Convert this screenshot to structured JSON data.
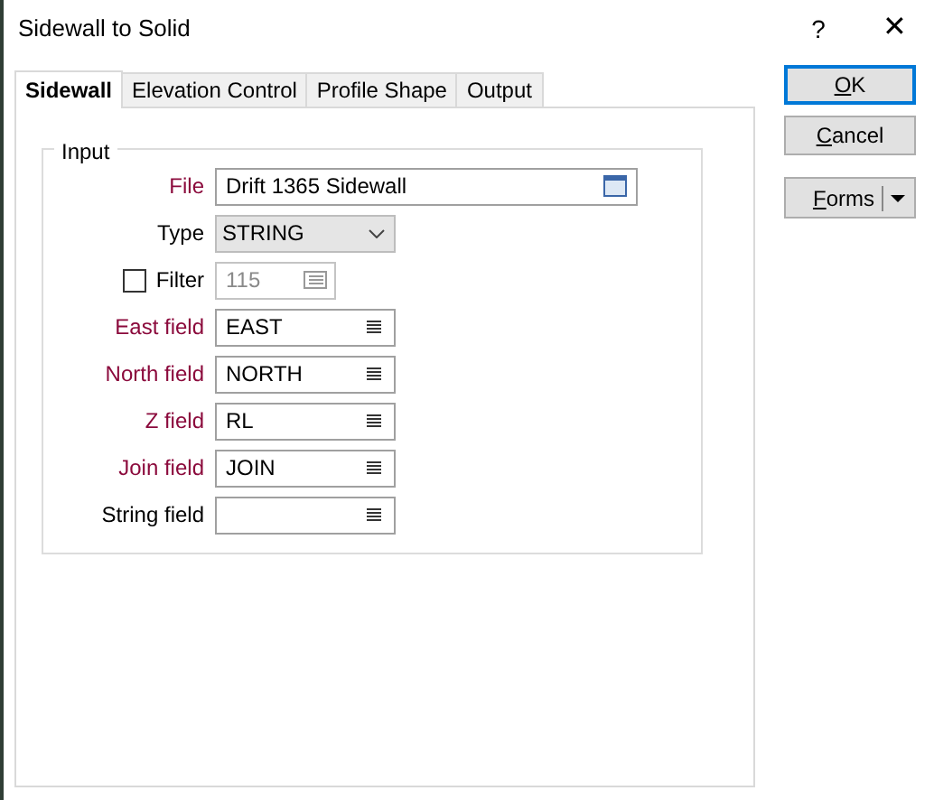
{
  "window": {
    "title": "Sidewall to Solid",
    "help": "?",
    "close": "✕"
  },
  "tabs": [
    {
      "label": "Sidewall",
      "selected": true
    },
    {
      "label": "Elevation Control",
      "selected": false
    },
    {
      "label": "Profile Shape",
      "selected": false
    },
    {
      "label": "Output",
      "selected": false
    }
  ],
  "group": {
    "title": "Input"
  },
  "fields": [
    {
      "kind": "file",
      "label": "File",
      "required": true,
      "value": "Drift 1365 Sidewall"
    },
    {
      "kind": "dropdown",
      "label": "Type",
      "required": false,
      "value": "STRING"
    },
    {
      "kind": "filter",
      "label": "Filter",
      "checked": false,
      "disabled": true,
      "value": "115"
    },
    {
      "kind": "list",
      "label": "East field",
      "required": true,
      "value": "EAST"
    },
    {
      "kind": "list",
      "label": "North field",
      "required": true,
      "value": "NORTH"
    },
    {
      "kind": "list",
      "label": "Z field",
      "required": true,
      "value": "RL"
    },
    {
      "kind": "list",
      "label": "Join field",
      "required": true,
      "value": "JOIN"
    },
    {
      "kind": "list",
      "label": "String field",
      "required": false
    }
  ],
  "buttons": [
    {
      "kind": "default",
      "label": "OK",
      "access_key": true
    },
    {
      "kind": "plain",
      "label": "Cancel",
      "access_key": true
    },
    {
      "kind": "split",
      "label": "Forms",
      "access_key": true
    }
  ]
}
